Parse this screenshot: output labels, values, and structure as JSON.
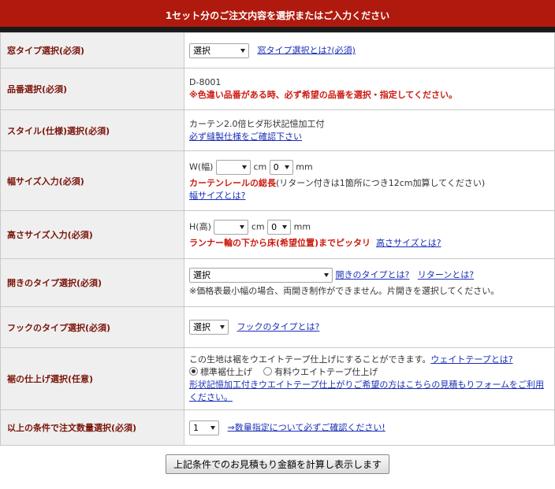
{
  "header": {
    "title": "1セット分のご注文内容を選択またはご入力ください"
  },
  "rows": {
    "window_type": {
      "label": "窓タイプ選択(必須)",
      "select": "選択",
      "link": "窓タイプ選択とは?(必須)"
    },
    "product_no": {
      "label": "品番選択(必須)",
      "code": "D-8001",
      "note": "※色違い品番がある時、必ず希望の品番を選択・指定してください。"
    },
    "style": {
      "label": "スタイル(仕様)選択(必須)",
      "text": "カーテン2.0倍ヒダ形状記憶加工付",
      "link": "必ず縫製仕様をご確認下さい"
    },
    "width": {
      "label": "幅サイズ入力(必須)",
      "prefix": "W(幅)",
      "cm_value": "",
      "cm_unit": "cm",
      "mm_value": "0",
      "mm_unit": "mm",
      "note_red": "カーテンレールの総長",
      "note": "(リターン付きは1箇所につき12cm加算してください)",
      "link": "幅サイズとは?"
    },
    "height": {
      "label": "高さサイズ入力(必須)",
      "prefix": "H(高)",
      "cm_value": "",
      "cm_unit": "cm",
      "mm_value": "0",
      "mm_unit": "mm",
      "note_red": "ランナー輪の下から床(希望位置)までピッタリ",
      "link": "高さサイズとは?"
    },
    "opening": {
      "label": "開きのタイプ選択(必須)",
      "select": "選択",
      "link1": "開きのタイプとは?",
      "link2": "リターンとは?",
      "note": "※価格表最小幅の場合、両開き制作ができません。片開きを選択してください。"
    },
    "hook": {
      "label": "フックのタイプ選択(必須)",
      "select": "選択",
      "link": "フックのタイプとは?"
    },
    "hem": {
      "label": "裾の仕上げ選択(任意)",
      "text": "この生地は裾をウエイトテープ仕上げにすることができます。",
      "link": "ウェイトテープとは?",
      "option1": "標準裾仕上げ",
      "option2": "有料ウエイトテープ仕上げ",
      "link2": "形状記憶加工付きウエイトテープ仕上がりご希望の方はこちらの見積もりフォームをご利用ください。"
    },
    "quantity": {
      "label": "以上の条件で注文数量選択(必須)",
      "select": "1",
      "link": "⇒数量指定について必ずご確認ください!"
    }
  },
  "submit": {
    "label": "上記条件でのお見積もり金額を計算し表示します"
  }
}
